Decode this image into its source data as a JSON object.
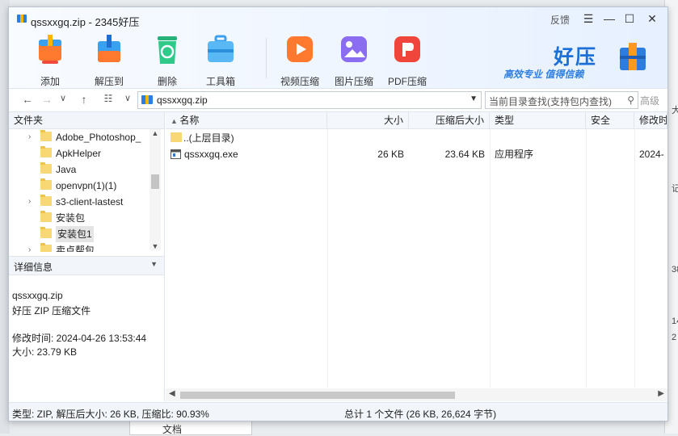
{
  "window": {
    "title": "qssxxgq.zip - 2345好压",
    "feedback": "反馈",
    "controls": {
      "menu": "☰",
      "minimize": "—",
      "maximize": "☐",
      "close": "✕"
    }
  },
  "toolbar": {
    "add": "添加",
    "extract_to": "解压到",
    "delete": "删除",
    "toolbox": "工具箱",
    "video_compress": "视频压缩",
    "image_compress": "图片压缩",
    "pdf_compress": "PDF压缩"
  },
  "brand": {
    "name": "好压",
    "slogan": "高效专业 值得信赖"
  },
  "address": {
    "path": "qssxxgq.zip",
    "search_placeholder": "当前目录查找(支持包内查找)",
    "advanced": "高级"
  },
  "sidebar": {
    "header": "文件夹",
    "items": [
      {
        "label": "Adobe_Photoshop_",
        "expandable": true
      },
      {
        "label": "ApkHelper",
        "expandable": false
      },
      {
        "label": "Java",
        "expandable": false
      },
      {
        "label": "openvpn(1)(1)",
        "expandable": false
      },
      {
        "label": "s3-client-lastest",
        "expandable": true
      },
      {
        "label": "安装包",
        "expandable": false
      },
      {
        "label": "安装包1",
        "expandable": false
      },
      {
        "label": "卖点帮包",
        "expandable": true
      }
    ]
  },
  "details": {
    "header": "详细信息",
    "filename": "qssxxgq.zip",
    "filetype": "好压 ZIP 压缩文件",
    "modified": "修改时间:  2024-04-26 13:53:44",
    "size": "大小:  23.79 KB"
  },
  "columns": [
    "名称",
    "大小",
    "压缩后大小",
    "类型",
    "安全",
    "修改时"
  ],
  "rows": [
    {
      "name": "..(上层目录)",
      "size": "",
      "packed": "",
      "type": "",
      "security": "",
      "modified": ""
    },
    {
      "name": "qssxxgq.exe",
      "size": "26 KB",
      "packed": "23.64 KB",
      "type": "应用程序",
      "security": "",
      "modified": "2024-"
    }
  ],
  "status": {
    "left": "类型: ZIP, 解压后大小: 26 KB, 压缩比: 90.93%",
    "right": "总计 1 个文件 (26 KB, 26,624 字节)"
  },
  "background": {
    "right_texts": [
      "大",
      "38",
      "14",
      "2",
      "记"
    ],
    "bottom_text": "文档"
  },
  "colors": {
    "accent": "#1b6fd6",
    "folder": "#f8d775"
  }
}
